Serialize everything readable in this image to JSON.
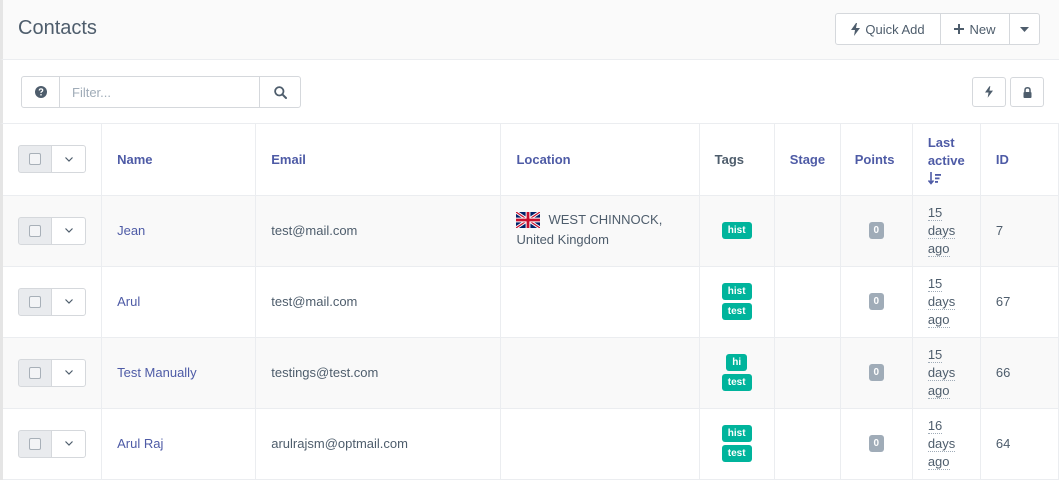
{
  "header": {
    "title": "Contacts",
    "quick_add_label": "Quick Add",
    "new_label": "New"
  },
  "toolbar": {
    "filter_placeholder": "Filter..."
  },
  "table": {
    "columns": {
      "name": "Name",
      "email": "Email",
      "location": "Location",
      "tags": "Tags",
      "stage": "Stage",
      "points": "Points",
      "last_active_1": "Last",
      "last_active_2": "active",
      "id": "ID"
    },
    "rows": [
      {
        "name": "Jean",
        "email": "test@mail.com",
        "location_city": "WEST CHINNOCK,",
        "location_country": "United Kingdom",
        "tags": [
          "hist"
        ],
        "stage": "",
        "points": "0",
        "last_active": [
          "15",
          "days",
          "ago"
        ],
        "id": "7"
      },
      {
        "name": "Arul",
        "email": "test@mail.com",
        "location_city": "",
        "location_country": "",
        "tags": [
          "hist",
          "test"
        ],
        "stage": "",
        "points": "0",
        "last_active": [
          "15",
          "days",
          "ago"
        ],
        "id": "67"
      },
      {
        "name": "Test Manually",
        "email": "testings@test.com",
        "location_city": "",
        "location_country": "",
        "tags": [
          "hi",
          "test"
        ],
        "stage": "",
        "points": "0",
        "last_active": [
          "15",
          "days",
          "ago"
        ],
        "id": "66"
      },
      {
        "name": "Arul Raj",
        "email": "arulrajsm@optmail.com",
        "location_city": "",
        "location_country": "",
        "tags": [
          "hist",
          "test"
        ],
        "stage": "",
        "points": "0",
        "last_active": [
          "16",
          "days",
          "ago"
        ],
        "id": "64"
      }
    ]
  },
  "colors": {
    "accent": "#4e5ba6",
    "tag": "#00b49c",
    "badge": "#a0acb8"
  }
}
